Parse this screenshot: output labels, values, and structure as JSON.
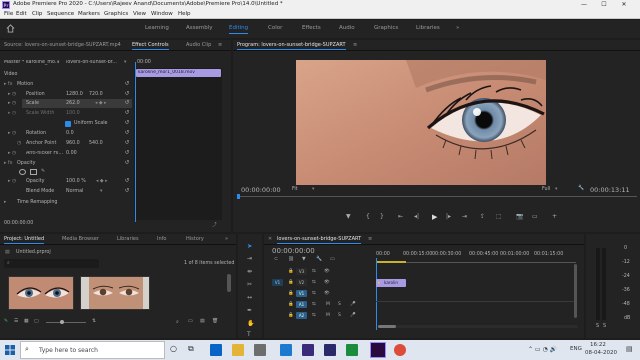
{
  "window": {
    "title": "Adobe Premiere Pro 2020 - C:\\Users\\Rajeev Anand\\Documents\\Adobe\\Premiere Pro\\14.0\\Untitled *",
    "minimize": "—",
    "maximize": "☐",
    "close": "✕"
  },
  "menu": [
    "File",
    "Edit",
    "Clip",
    "Sequence",
    "Markers",
    "Graphics",
    "View",
    "Window",
    "Help"
  ],
  "workspaces": [
    "Learning",
    "Assembly",
    "Editing",
    "Color",
    "Effects",
    "Audio",
    "Graphics",
    "Libraries",
    "»"
  ],
  "workspace_active": "Editing",
  "source_panel": {
    "tabs": [
      "Source: lovers-on-sunset-bridge-SUPZART.mp4",
      "Effect Controls",
      "Audio Clip"
    ],
    "active_tab": "Effect Controls",
    "menu_icon": "≡",
    "master_label": "Master * karoline_mo...",
    "master_seq": "lovers-on-sunset-br...",
    "timecode_ruler": "00:00",
    "clip_name": "karoline_mor1_0018.mov",
    "section_video": "Video",
    "motion": "Motion",
    "position_label": "Position",
    "position_x": "1280.0",
    "position_y": "720.0",
    "scale_label": "Scale",
    "scale_val": "262.0",
    "scale_width_label": "Scale Width",
    "scale_width_val": "100.0",
    "uniform_scale": "Uniform Scale",
    "rotation_label": "Rotation",
    "rotation_val": "0.0",
    "anchor_label": "Anchor Point",
    "anchor_x": "960.0",
    "anchor_y": "540.0",
    "antiflicker_label": "Anti-flicker Fil...",
    "antiflicker_val": "0.00",
    "opacity_section": "Opacity",
    "opacity_label": "Opacity",
    "opacity_val": "100.0 %",
    "blend_label": "Blend Mode",
    "blend_val": "Normal",
    "time_remap": "Time Remapping",
    "timecode": "00:00:00:00"
  },
  "program_panel": {
    "title": "Program: lovers-on-sunset-bridge-SUPZART",
    "menu_icon": "≡",
    "timecode": "00:00:00:00",
    "fit": "Fit",
    "resolution": "Full",
    "duration": "00:00:13:11"
  },
  "project_panel": {
    "tabs": [
      "Project: Untitled",
      "Media Browser",
      "Libraries",
      "Info",
      "History"
    ],
    "active_tab": "Project: Untitled",
    "menu_icon": "»",
    "file_name": "Untitled.prproj",
    "items_count": "1 of 8 items selected"
  },
  "timeline_panel": {
    "title": "lovers-on-sunset-bridge-SUPZART",
    "timecode": "00:00:00:00",
    "ruler": [
      "00:00",
      "00:00:15:00",
      "00:00:30:00",
      "00:00:45:00",
      "00:01:00:00",
      "00:01:15:00"
    ],
    "tracks": [
      {
        "src": "",
        "name": "V3"
      },
      {
        "src": "V1",
        "name": "V2"
      },
      {
        "src": "",
        "name": "V1"
      },
      {
        "src": "",
        "name": "A1"
      },
      {
        "src": "",
        "name": "A2"
      }
    ],
    "clip_label": "karolin"
  },
  "audio_meter": {
    "scale": [
      "0",
      "-12",
      "-24",
      "-36",
      "-48",
      "dB"
    ],
    "solo": "S",
    "solo2": "S"
  },
  "taskbar": {
    "search_placeholder": "Type here to search",
    "lang": "ENG",
    "time": "16:22",
    "date": "08-04-2020"
  },
  "colors": {
    "accent": "#2d8ceb",
    "clip": "#a99be3",
    "panel": "#232323"
  }
}
